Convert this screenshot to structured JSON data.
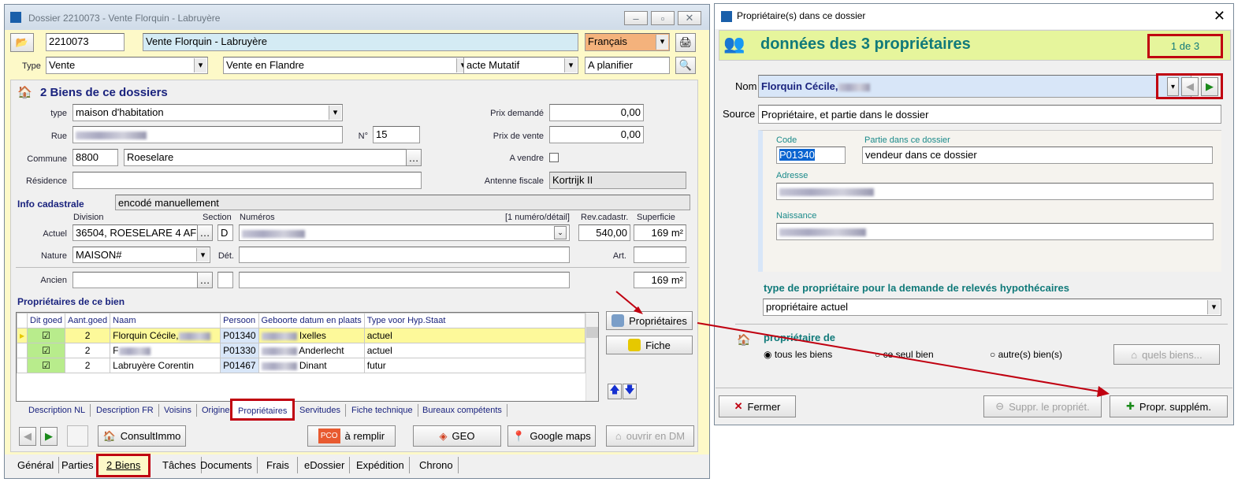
{
  "main_window": {
    "title": "Dossier 2210073 - Vente Florquin - Labruyère",
    "dossier_number": "2210073",
    "dossier_name": "Vente Florquin - Labruyère",
    "language": "Français",
    "type_label": "Type",
    "type": "Vente",
    "subtype": "Vente en Flandre",
    "acte": "acte Mutatif",
    "status": "A planifier",
    "section_title": "2 Biens de ce dossiers",
    "labels": {
      "type": "type",
      "rue": "Rue",
      "no": "N°",
      "commune": "Commune",
      "residence": "Résidence",
      "prix_demande": "Prix demandé",
      "prix_vente": "Prix de vente",
      "a_vendre": "A vendre",
      "antenne": "Antenne fiscale",
      "info_cad": "Info cadastrale",
      "division": "Division",
      "section": "Section",
      "numeros": "Numéros",
      "num_detail": "[1 numéro/détail]",
      "rev": "Rev.cadastr.",
      "superficie": "Superficie",
      "actuel": "Actuel",
      "nature": "Nature",
      "det": "Dét.",
      "art": "Art.",
      "ancien": "Ancien"
    },
    "bien_type": "maison d'habitation",
    "rue": "",
    "numero": "15",
    "code_postal": "8800",
    "commune": "Roeselare",
    "residence": "",
    "prix_demande": "0,00",
    "prix_vente": "0,00",
    "antenne": "Kortrijk II",
    "info_cad": "encodé manuellement",
    "division": "36504, ROESELARE  4 AF",
    "section": "D",
    "rev": "540,00",
    "superficie": "169 m²",
    "nature": "MAISON#",
    "ancien_superficie": "169 m²",
    "owners_title": "Propriétaires de ce bien",
    "columns": [
      "Dit goed",
      "Aant.goed",
      "Naam",
      "Persoon",
      "Geboorte datum en plaats",
      "Type voor Hyp.Staat"
    ],
    "rows": [
      {
        "aant": "2",
        "naam": "Florquin Cécile,",
        "persoon": "P01340",
        "geboorte": "Ixelles",
        "type": "actuel"
      },
      {
        "aant": "2",
        "naam": "F",
        "persoon": "P01330",
        "geboorte": "Anderlecht",
        "type": "actuel"
      },
      {
        "aant": "2",
        "naam": "Labruyère Corentin",
        "persoon": "P01467",
        "geboorte": "Dinant",
        "type": "futur"
      }
    ],
    "btn_proprietaires": "Propriétaires",
    "btn_fiche": "Fiche",
    "subtabs": [
      "Description NL",
      "Description FR",
      "Voisins",
      "Origine",
      "Propriétaires",
      "Servitudes",
      "Fiche technique",
      "Bureaux compétents"
    ],
    "btn_consult": "ConsultImmo",
    "btn_remplir": "à remplir",
    "pco": "PCO",
    "btn_geo": "GEO",
    "btn_maps": "Google maps",
    "btn_dm": "ouvrir en DM",
    "tabs": [
      "Général",
      "Parties",
      "2 Biens",
      "Tâches",
      "Documents",
      "Frais",
      "eDossier",
      "Expédition",
      "Chrono"
    ]
  },
  "dialog": {
    "title": "Propriétaire(s) dans ce dossier",
    "header": "données des 3 propriétaires",
    "counter": "1 de 3",
    "nom_label": "Nom",
    "nom": "Florquin Cécile,",
    "source_label": "Source",
    "source": "Propriétaire, et partie dans le dossier",
    "code_label": "Code",
    "code": "P01340",
    "partie_label": "Partie dans ce dossier",
    "partie": "vendeur dans ce dossier",
    "adresse_label": "Adresse",
    "naissance_label": "Naissance",
    "type_title": "type de propriétaire pour la demande de relevés hypothécaires",
    "type_value": "propriétaire actuel",
    "prop_de": "propriétaire de",
    "radio": [
      "tous les biens",
      "ce seul bien",
      "autre(s) bien(s)"
    ],
    "quels": "quels biens...",
    "fermer": "Fermer",
    "suppr": "Suppr. le propriét.",
    "suppl": "Propr. supplém."
  },
  "colors": {
    "accent_red": "#c00010",
    "header_green": "#e6f59c",
    "title_teal": "#117a7a",
    "yellow_bg": "#fdf9c8",
    "row_highlight": "#fdf99a"
  }
}
